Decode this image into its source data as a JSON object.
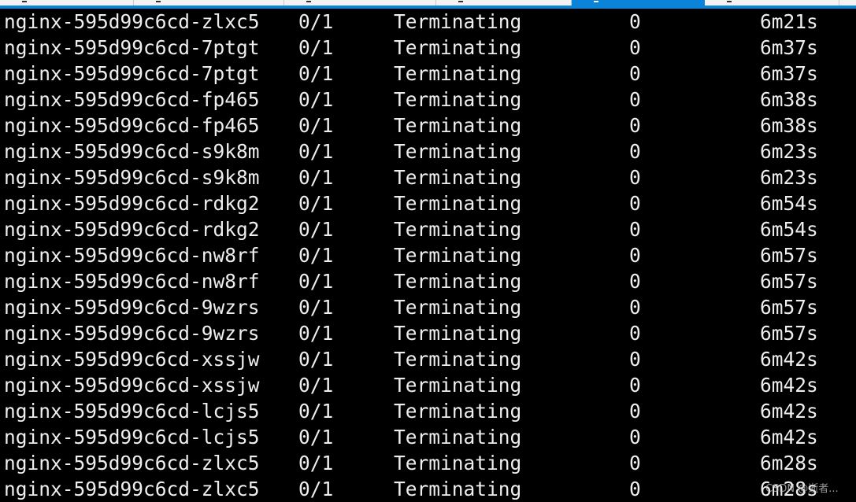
{
  "tabs": [
    {
      "active": false
    },
    {
      "active": false
    },
    {
      "active": false
    },
    {
      "active": false
    },
    {
      "active": true
    },
    {
      "active": false
    }
  ],
  "accent_color": "#0a84d8",
  "rows": [
    [
      "nginx-595d99c6cd-zlxc5",
      "0/1",
      "Terminating",
      "0",
      "6m21s"
    ],
    [
      "nginx-595d99c6cd-7ptgt",
      "0/1",
      "Terminating",
      "0",
      "6m37s"
    ],
    [
      "nginx-595d99c6cd-7ptgt",
      "0/1",
      "Terminating",
      "0",
      "6m37s"
    ],
    [
      "nginx-595d99c6cd-fp465",
      "0/1",
      "Terminating",
      "0",
      "6m38s"
    ],
    [
      "nginx-595d99c6cd-fp465",
      "0/1",
      "Terminating",
      "0",
      "6m38s"
    ],
    [
      "nginx-595d99c6cd-s9k8m",
      "0/1",
      "Terminating",
      "0",
      "6m23s"
    ],
    [
      "nginx-595d99c6cd-s9k8m",
      "0/1",
      "Terminating",
      "0",
      "6m23s"
    ],
    [
      "nginx-595d99c6cd-rdkg2",
      "0/1",
      "Terminating",
      "0",
      "6m54s"
    ],
    [
      "nginx-595d99c6cd-rdkg2",
      "0/1",
      "Terminating",
      "0",
      "6m54s"
    ],
    [
      "nginx-595d99c6cd-nw8rf",
      "0/1",
      "Terminating",
      "0",
      "6m57s"
    ],
    [
      "nginx-595d99c6cd-nw8rf",
      "0/1",
      "Terminating",
      "0",
      "6m57s"
    ],
    [
      "nginx-595d99c6cd-9wzrs",
      "0/1",
      "Terminating",
      "0",
      "6m57s"
    ],
    [
      "nginx-595d99c6cd-9wzrs",
      "0/1",
      "Terminating",
      "0",
      "6m57s"
    ],
    [
      "nginx-595d99c6cd-xssjw",
      "0/1",
      "Terminating",
      "0",
      "6m42s"
    ],
    [
      "nginx-595d99c6cd-xssjw",
      "0/1",
      "Terminating",
      "0",
      "6m42s"
    ],
    [
      "nginx-595d99c6cd-lcjs5",
      "0/1",
      "Terminating",
      "0",
      "6m42s"
    ],
    [
      "nginx-595d99c6cd-lcjs5",
      "0/1",
      "Terminating",
      "0",
      "6m42s"
    ],
    [
      "nginx-595d99c6cd-zlxc5",
      "0/1",
      "Terminating",
      "0",
      "6m28s"
    ],
    [
      "nginx-595d99c6cd-zlxc5",
      "0/1",
      "Terminating",
      "0",
      "6m28s"
    ]
  ],
  "watermark": "CSDN @逝者..."
}
